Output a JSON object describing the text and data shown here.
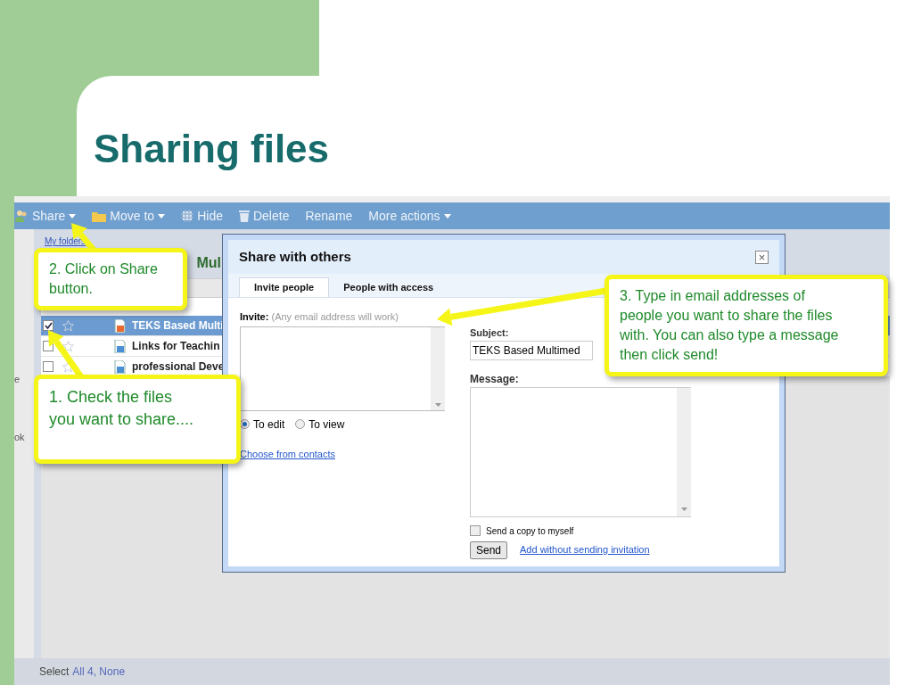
{
  "slide": {
    "title": "Sharing files"
  },
  "toolbar": [
    {
      "label": "Share",
      "kind": "menu"
    },
    {
      "label": "Move to",
      "kind": "menu"
    },
    {
      "label": "Hide",
      "kind": "plain"
    },
    {
      "label": "Delete",
      "kind": "plain"
    },
    {
      "label": "Rename",
      "kind": "text"
    },
    {
      "label": "More actions",
      "kind": "menu"
    }
  ],
  "sidebar": {
    "items": [
      "e",
      "ok"
    ]
  },
  "breadcrumb": "My folders",
  "folder_title": "Mul",
  "files": [
    {
      "name": "TEKS Based Multi",
      "selected": true
    },
    {
      "name": "Links for Teachin",
      "selected": false
    },
    {
      "name": "professional Deve",
      "selected": false
    }
  ],
  "footer": {
    "label": "Select",
    "links": "All 4, None"
  },
  "dialog": {
    "title": "Share with others",
    "close": "×",
    "tabs": [
      {
        "label": "Invite people",
        "selected": true
      },
      {
        "label": "People with access",
        "selected": false
      }
    ],
    "invite_label": "Invite:",
    "invite_hint": "(Any email address will work)",
    "permissions": [
      {
        "label": "To edit",
        "selected": true
      },
      {
        "label": "To view",
        "selected": false
      }
    ],
    "contacts_link": "Choose from contacts",
    "subject_label": "Subject:",
    "subject_value": "TEKS Based Multimed",
    "message_label": "Message:",
    "copy_checkbox": {
      "label": "Send a copy to myself",
      "checked": false
    },
    "send_button": "Send",
    "add_link": "Add without sending invitation"
  },
  "callouts": [
    {
      "text": "2. Click on Share button."
    },
    {
      "text": "1. Check the files you want to share...."
    },
    {
      "text": "3. Type in email addresses of people you want to share the files with.  You can also type a message then click send!"
    }
  ]
}
